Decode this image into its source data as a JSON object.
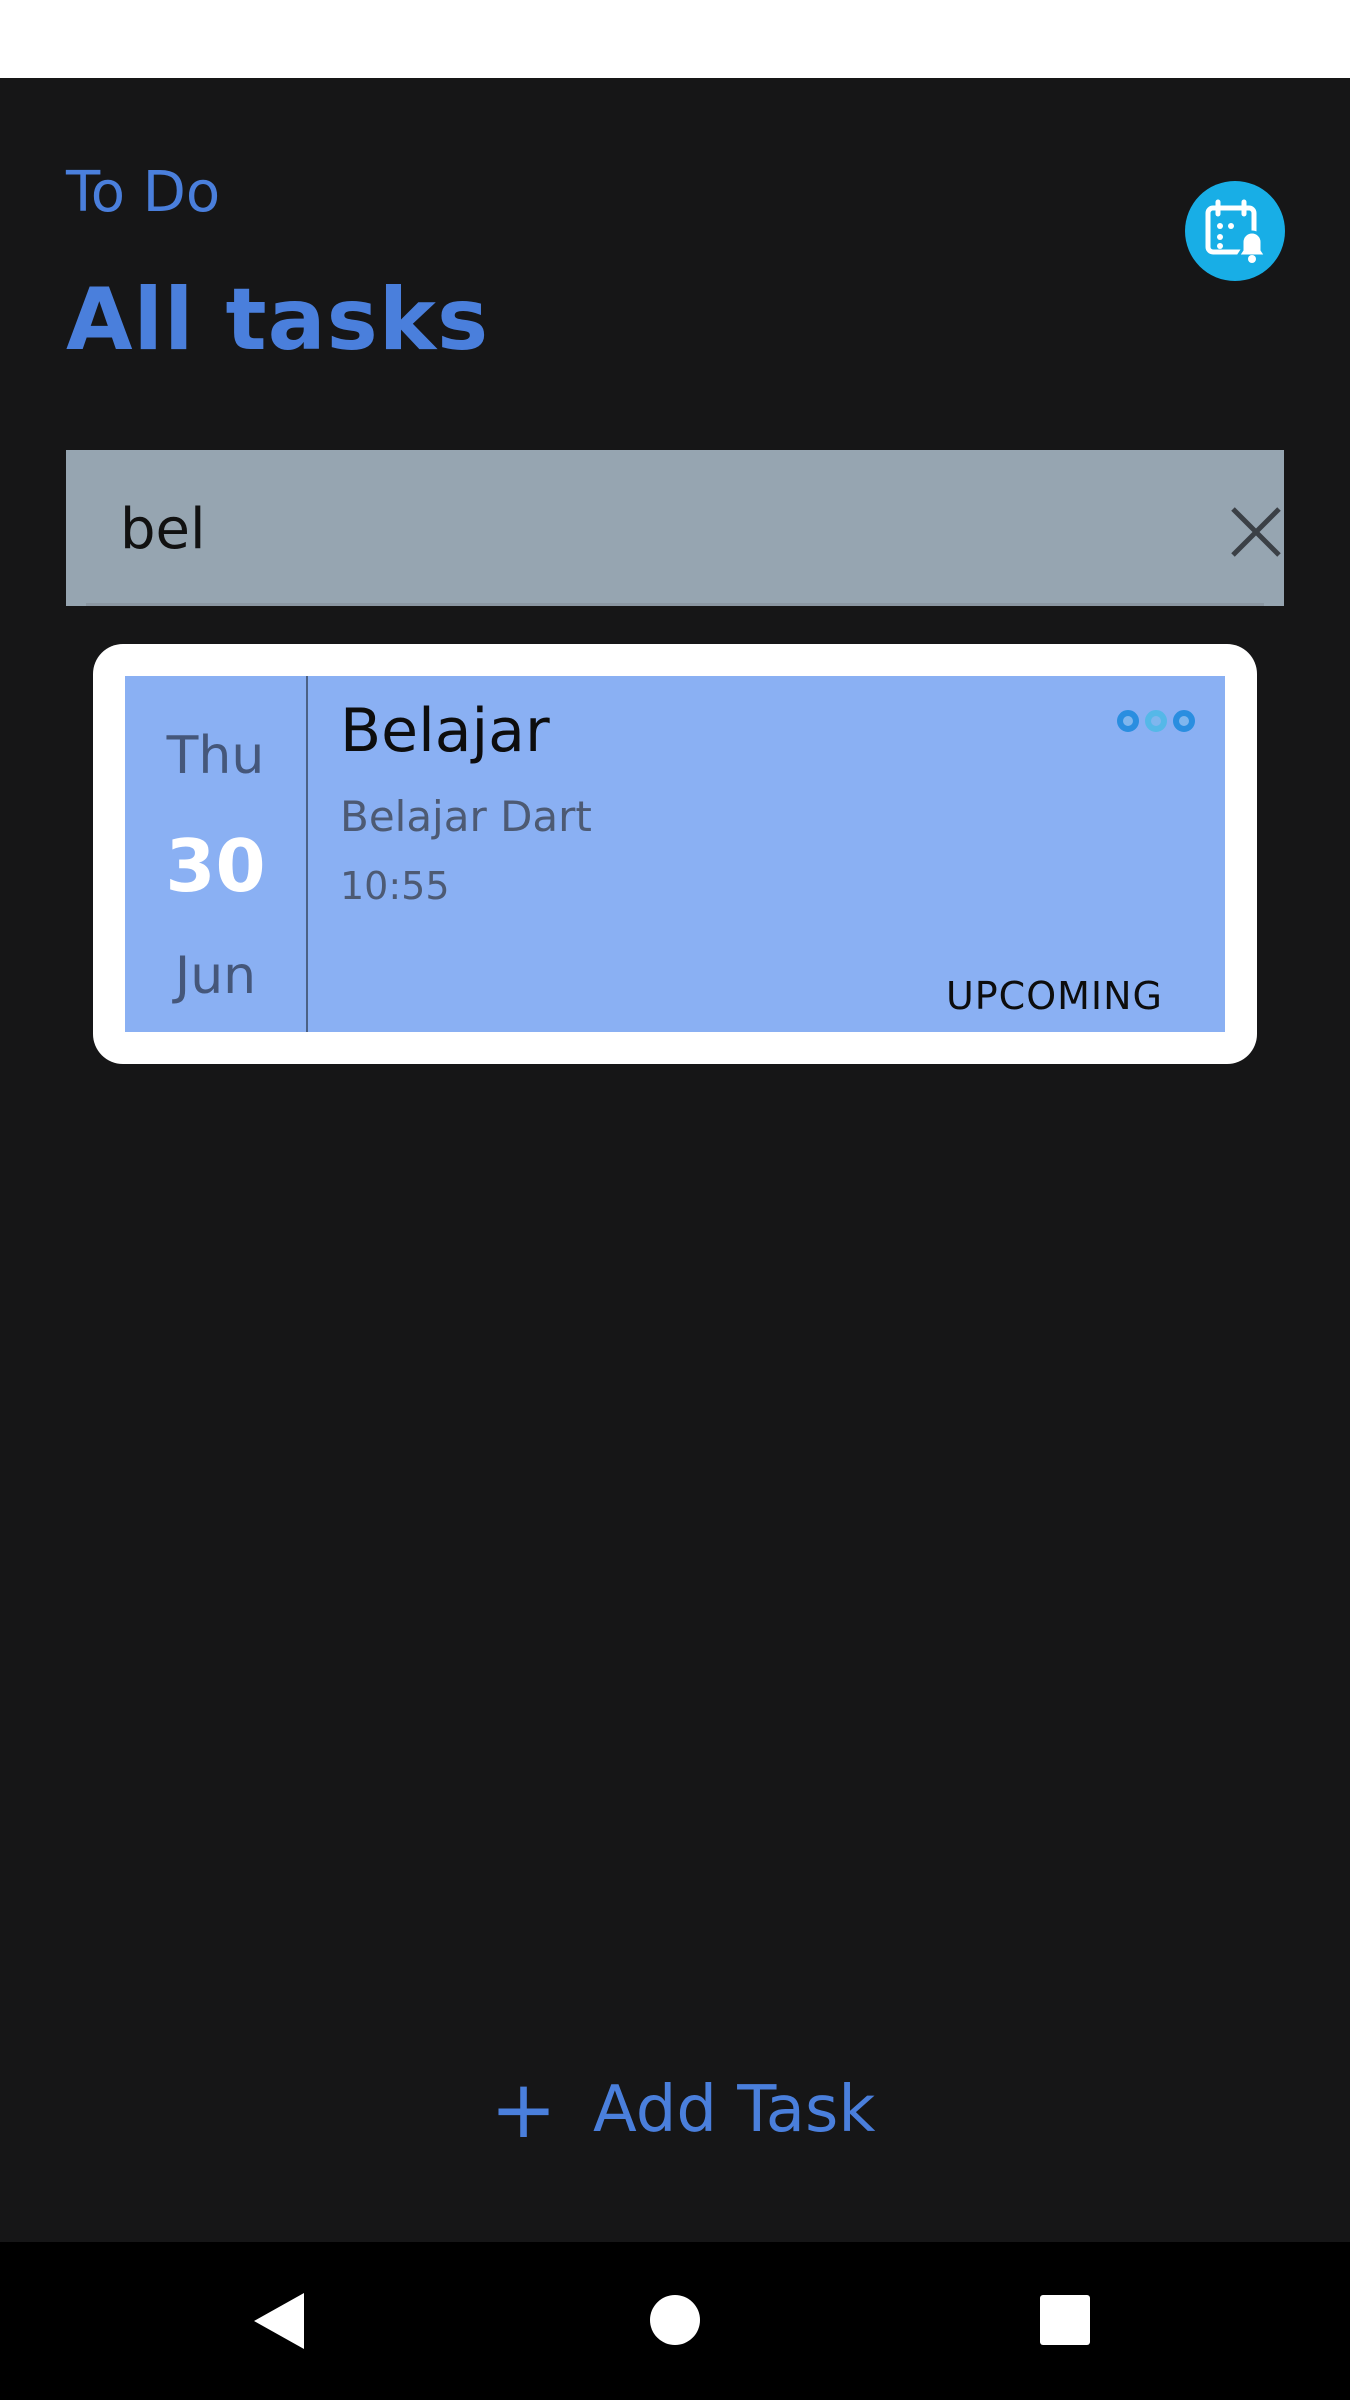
{
  "header": {
    "app_label": "To Do",
    "page_title": "All tasks"
  },
  "search": {
    "value": "bel",
    "placeholder": ""
  },
  "tasks": [
    {
      "day_of_week": "Thu",
      "day": "30",
      "month": "Jun",
      "title": "Belajar",
      "description": "Belajar Dart",
      "time": "10:55",
      "status": "UPCOMING"
    }
  ],
  "footer": {
    "add_task_label": "Add Task"
  },
  "icons": {
    "calendar": "calendar-bell-icon",
    "clear": "close-icon",
    "add": "plus-icon",
    "more": "more-dots-icon",
    "nav_back": "back-triangle-icon",
    "nav_home": "home-circle-icon",
    "nav_recents": "recents-square-icon"
  },
  "colors": {
    "background": "#161617",
    "accent": "#4a7fdc",
    "search_bg": "#96a5b1",
    "card_bg": "#8ab0f3",
    "calendar_btn": "#18aee6"
  }
}
